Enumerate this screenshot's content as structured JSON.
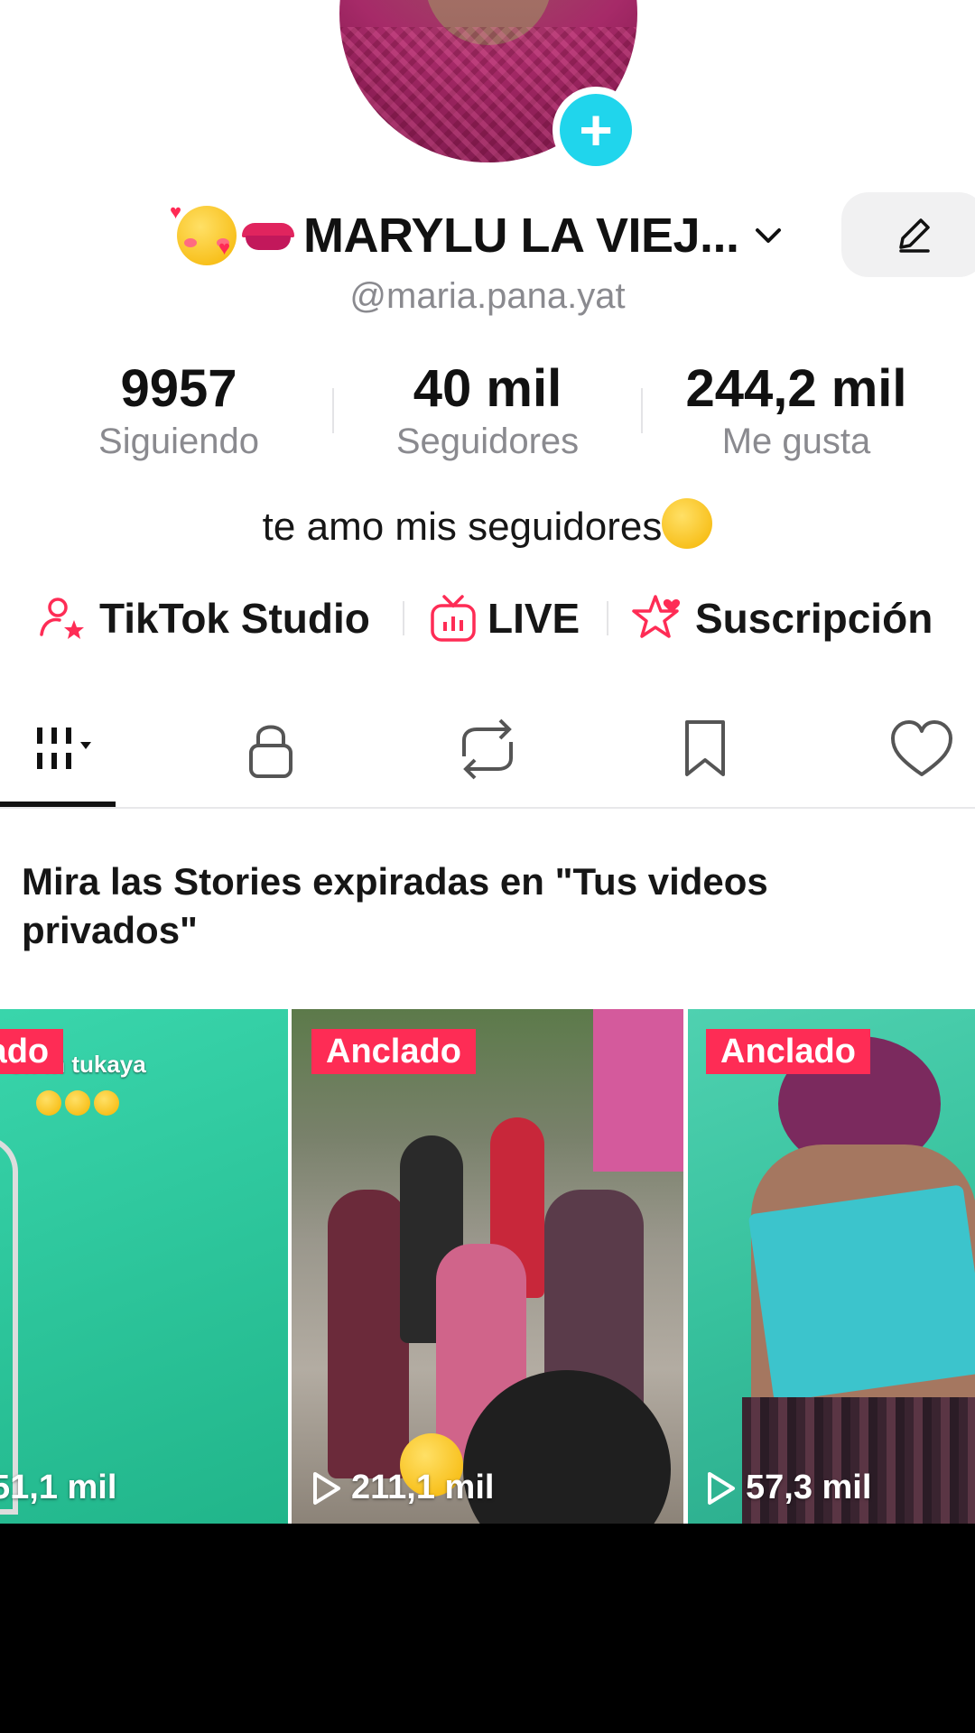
{
  "profile": {
    "display_name": "MARYLU LA VIEJ...",
    "username": "@maria.pana.yat",
    "bio": "te amo mis seguidores"
  },
  "stats": [
    {
      "value": "9957",
      "label": "Siguiendo"
    },
    {
      "value": "40 mil",
      "label": "Seguidores"
    },
    {
      "value": "244,2 mil",
      "label": "Me gusta"
    }
  ],
  "actions": [
    {
      "label": "TikTok Studio",
      "icon": "person-star-icon"
    },
    {
      "label": "LIVE",
      "icon": "tv-icon"
    },
    {
      "label": "Suscripción",
      "icon": "star-heart-icon"
    }
  ],
  "tabs": [
    {
      "name": "videos",
      "icon": "grid-icon",
      "active": true
    },
    {
      "name": "private",
      "icon": "lock-icon"
    },
    {
      "name": "reposts",
      "icon": "repost-icon"
    },
    {
      "name": "favorites",
      "icon": "bookmark-icon"
    },
    {
      "name": "liked",
      "icon": "heart-icon"
    }
  ],
  "notice": "Mira las Stories expiradas en \"Tus videos privados\"",
  "videos": [
    {
      "badge": "lado",
      "views": "51,1 mil",
      "caption": "on m tukaya"
    },
    {
      "badge": "Anclado",
      "views": "211,1 mil"
    },
    {
      "badge": "Anclado",
      "views": "57,3 mil"
    }
  ],
  "colors": {
    "accent": "#fe2c55",
    "add_badge": "#20d5ec",
    "text_primary": "#161616",
    "text_secondary": "#8a8a8f"
  }
}
